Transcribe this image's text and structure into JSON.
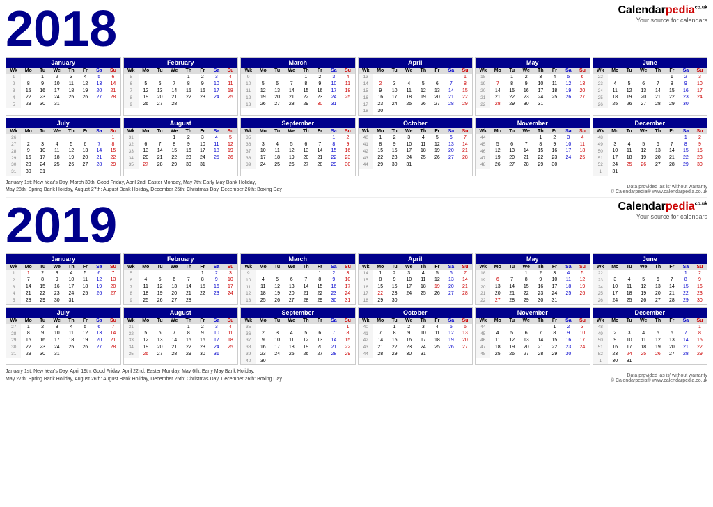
{
  "year2018": {
    "label": "2018",
    "notes": "January 1st: New Year's Day, March 30th: Good Friday, April 2nd: Easter Monday, May 7th: Early May Bank Holiday, May 28th: Spring Bank Holiday, August 27th: August Bank Holiday, December 25th: Christmas Day, December 26th: Boxing Day"
  },
  "year2019": {
    "label": "2019",
    "notes": "January 1st: New Year's Day, April 19th: Good Friday, April 22nd: Easter Monday, May 6th: Early May Bank Holiday, May 27th: Spring Bank Holiday, August 26th: August Bank Holiday, December 25th: Christmas Day, December 26th: Boxing Day"
  },
  "logo": {
    "name": "Calendarpedia",
    "tagline": "Your source for calendars",
    "domain": "co.uk"
  }
}
